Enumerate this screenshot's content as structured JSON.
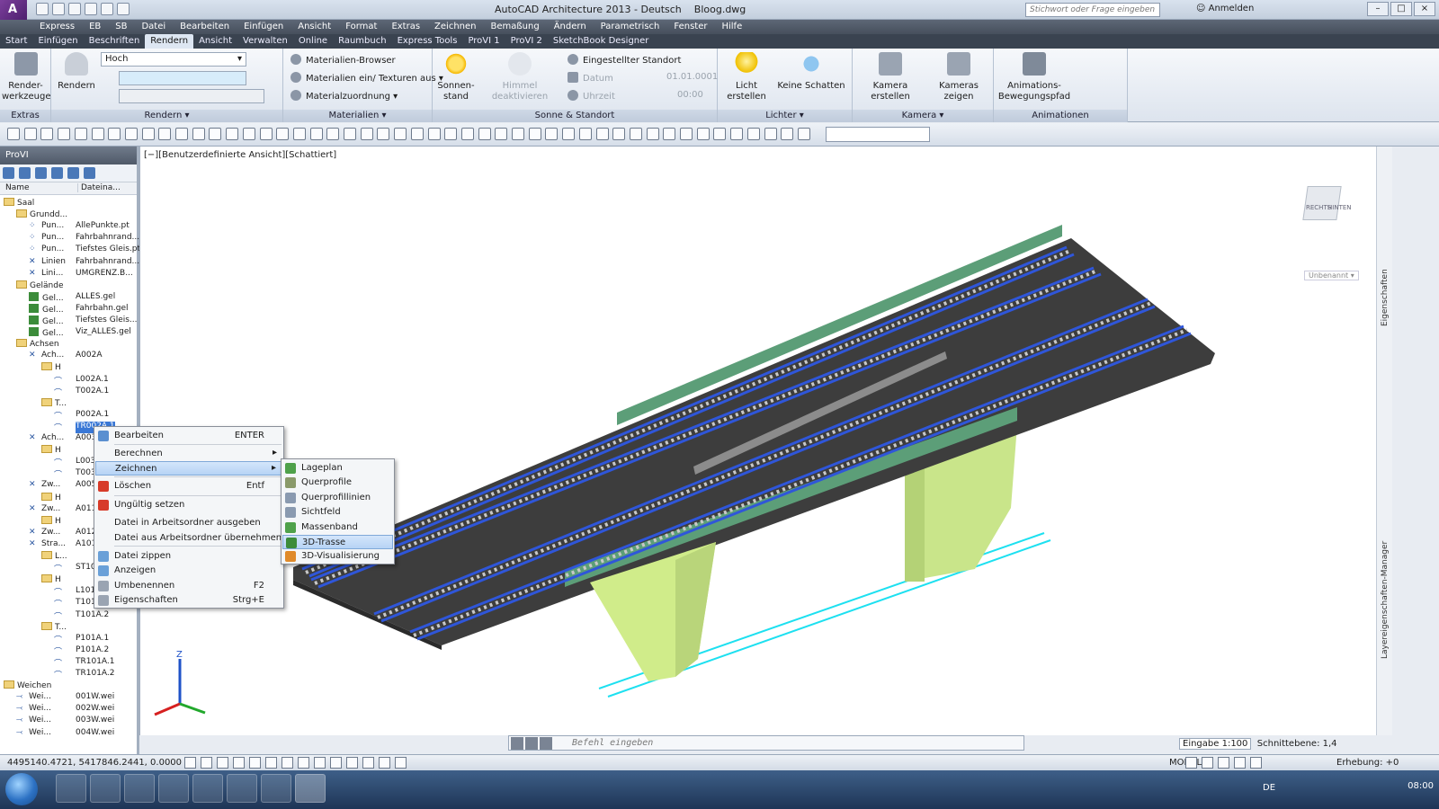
{
  "window": {
    "title": "AutoCAD Architecture 2013 - Deutsch",
    "file": "Bloog.dwg",
    "search_placeholder": "Stichwort oder Frage eingeben",
    "user": "Anmelden"
  },
  "menubar": [
    "Express",
    "EB",
    "SB",
    "Datei",
    "Bearbeiten",
    "Einfügen",
    "Ansicht",
    "Format",
    "Extras",
    "Zeichnen",
    "Bemaßung",
    "Ändern",
    "Parametrisch",
    "Fenster",
    "Hilfe"
  ],
  "ribbon_tabs": [
    "Start",
    "Einfügen",
    "Beschriften",
    "Rendern",
    "Ansicht",
    "Verwalten",
    "Online",
    "Raumbuch",
    "Express Tools",
    "ProVI 1",
    "ProVI 2",
    "SketchBook Designer"
  ],
  "active_tab": "Rendern",
  "ribbon": {
    "extras": {
      "label": "Extras",
      "button": "Render-\nwerkzeuge"
    },
    "rendern": {
      "label": "Rendern",
      "button": "Rendern",
      "quality": "Hoch"
    },
    "materialien": {
      "label": "Materialien",
      "items": [
        "Materialien-Browser",
        "Materialien ein/ Texturen aus",
        "Materialzuordnung"
      ]
    },
    "sonne": {
      "label": "Sonne & Standort",
      "sonnenstand": "Sonnen-\nstand",
      "himmel": "Himmel deaktivieren",
      "standort": "Eingestellter Standort",
      "datum_label": "Datum",
      "datum": "01.01.0001",
      "uhrzeit_label": "Uhrzeit",
      "uhrzeit": "00:00"
    },
    "lichter": {
      "label": "Lichter",
      "licht": "Licht\nerstellen",
      "schatten": "Keine Schatten"
    },
    "kamera": {
      "label": "Kamera",
      "erstellen": "Kamera erstellen",
      "zeigen": "Kameras zeigen"
    },
    "animationen": {
      "label": "Animationen",
      "pfad": "Animations-\nBewegungspfad"
    }
  },
  "left_panel": {
    "title": "ProVI",
    "col_name": "Name",
    "col_file": "Dateina...",
    "tree": [
      {
        "level": 0,
        "name": "Saal",
        "file": "",
        "icon": "folder"
      },
      {
        "level": 1,
        "name": "Grundd...",
        "file": "",
        "icon": "folder"
      },
      {
        "level": 2,
        "name": "Pun...",
        "file": "AllePunkte.pt",
        "icon": "points"
      },
      {
        "level": 2,
        "name": "Pun...",
        "file": "Fahrbahnrand...",
        "icon": "points"
      },
      {
        "level": 2,
        "name": "Pun...",
        "file": "Tiefstes Gleis.pt",
        "icon": "points"
      },
      {
        "level": 2,
        "name": "Linien",
        "file": "Fahrbahnrand...",
        "icon": "lines"
      },
      {
        "level": 2,
        "name": "Lini...",
        "file": "UMGRENZ.B...",
        "icon": "lines"
      },
      {
        "level": 1,
        "name": "Gelände",
        "file": "",
        "icon": "folder"
      },
      {
        "level": 2,
        "name": "Gel...",
        "file": "ALLES.gel",
        "icon": "terrain"
      },
      {
        "level": 2,
        "name": "Gel...",
        "file": "Fahrbahn.gel",
        "icon": "terrain"
      },
      {
        "level": 2,
        "name": "Gel...",
        "file": "Tiefstes Gleis...",
        "icon": "terrain"
      },
      {
        "level": 2,
        "name": "Gel...",
        "file": "Viz_ALLES.gel",
        "icon": "terrain"
      },
      {
        "level": 1,
        "name": "Achsen",
        "file": "",
        "icon": "folder"
      },
      {
        "level": 2,
        "name": "Ach...",
        "file": "A002A",
        "icon": "axis"
      },
      {
        "level": 3,
        "name": "H",
        "file": "",
        "icon": "folder"
      },
      {
        "level": 4,
        "name": "",
        "file": "L002A.1",
        "icon": "profile"
      },
      {
        "level": 4,
        "name": "",
        "file": "T002A.1",
        "icon": "profile"
      },
      {
        "level": 3,
        "name": "T...",
        "file": "",
        "icon": "folder"
      },
      {
        "level": 4,
        "name": "",
        "file": "P002A.1",
        "icon": "profile"
      },
      {
        "level": 4,
        "name": "",
        "file": "TR002A.1",
        "icon": "profile"
      },
      {
        "level": 2,
        "name": "Ach...",
        "file": "A003",
        "icon": "axis"
      },
      {
        "level": 3,
        "name": "H",
        "file": "",
        "icon": "folder"
      },
      {
        "level": 4,
        "name": "",
        "file": "L003",
        "icon": "profile"
      },
      {
        "level": 4,
        "name": "",
        "file": "T003",
        "icon": "profile"
      },
      {
        "level": 2,
        "name": "Zw...",
        "file": "A005",
        "icon": "axis"
      },
      {
        "level": 3,
        "name": "H",
        "file": "",
        "icon": "folder"
      },
      {
        "level": 2,
        "name": "Zw...",
        "file": "A011",
        "icon": "axis"
      },
      {
        "level": 3,
        "name": "H",
        "file": "",
        "icon": "folder"
      },
      {
        "level": 2,
        "name": "Zw...",
        "file": "A012",
        "icon": "axis"
      },
      {
        "level": 2,
        "name": "Stra...",
        "file": "A101",
        "icon": "axis"
      },
      {
        "level": 3,
        "name": "L...",
        "file": "",
        "icon": "folder"
      },
      {
        "level": 4,
        "name": "",
        "file": "ST10",
        "icon": "profile"
      },
      {
        "level": 3,
        "name": "H",
        "file": "",
        "icon": "folder"
      },
      {
        "level": 4,
        "name": "",
        "file": "L101",
        "icon": "profile"
      },
      {
        "level": 4,
        "name": "",
        "file": "T101",
        "icon": "profile"
      },
      {
        "level": 4,
        "name": "",
        "file": "T101A.2",
        "icon": "profile"
      },
      {
        "level": 3,
        "name": "T...",
        "file": "",
        "icon": "folder"
      },
      {
        "level": 4,
        "name": "",
        "file": "P101A.1",
        "icon": "profile"
      },
      {
        "level": 4,
        "name": "",
        "file": "P101A.2",
        "icon": "profile"
      },
      {
        "level": 4,
        "name": "",
        "file": "TR101A.1",
        "icon": "profile"
      },
      {
        "level": 4,
        "name": "",
        "file": "TR101A.2",
        "icon": "profile"
      },
      {
        "level": 0,
        "name": "Weichen",
        "file": "",
        "icon": "folder"
      },
      {
        "level": 1,
        "name": "Wei...",
        "file": "001W.wei",
        "icon": "switch"
      },
      {
        "level": 1,
        "name": "Wei...",
        "file": "002W.wei",
        "icon": "switch"
      },
      {
        "level": 1,
        "name": "Wei...",
        "file": "003W.wei",
        "icon": "switch"
      },
      {
        "level": 1,
        "name": "Wei...",
        "file": "004W.wei",
        "icon": "switch"
      }
    ]
  },
  "viewport": {
    "label": "[−][Benutzerdefinierte Ansicht][Schattiert]",
    "viewcube_faces": [
      "RECHTS",
      "HINTEN"
    ],
    "unnamed": "Unbenannt",
    "side_labels": [
      "Eigenschaften",
      "Layereigenschaften-Manager"
    ]
  },
  "context_menu": [
    {
      "label": "Bearbeiten",
      "shortcut": "ENTER"
    },
    {
      "label": "Berechnen",
      "shortcut": "",
      "submenu": true
    },
    {
      "label": "Zeichnen",
      "shortcut": "",
      "submenu": true,
      "highlight": true
    },
    {
      "label": "Löschen",
      "shortcut": "Entf"
    },
    {
      "label": "Ungültig setzen",
      "shortcut": ""
    },
    {
      "label": "Datei in Arbeitsordner ausgeben",
      "shortcut": ""
    },
    {
      "label": "Datei aus Arbeitsordner übernehmen",
      "shortcut": ""
    },
    {
      "label": "Datei zippen",
      "shortcut": ""
    },
    {
      "label": "Anzeigen",
      "shortcut": ""
    },
    {
      "label": "Umbenennen",
      "shortcut": "F2"
    },
    {
      "label": "Eigenschaften",
      "shortcut": "Strg+E"
    }
  ],
  "submenu": [
    {
      "label": "Lageplan"
    },
    {
      "label": "Querprofile"
    },
    {
      "label": "Querprofillinien"
    },
    {
      "label": "Sichtfeld"
    },
    {
      "label": "Massenband"
    },
    {
      "label": "3D-Trasse",
      "highlight": true
    },
    {
      "label": "3D-Visualisierung"
    }
  ],
  "command_line": {
    "placeholder": "Befehl eingeben"
  },
  "annotation": {
    "scale": "Eingabe 1:100",
    "cut_plane": "Schnittebene: 1,4"
  },
  "status": {
    "coords": "4495140.4721, 5417846.2441, 0.0000",
    "model": "MODELL",
    "elevation": "Erhebung: +0"
  },
  "taskbar": {
    "lang": "DE",
    "time": "08:00"
  },
  "colors": {
    "deck": "#3a3a3a",
    "rail": "#2f56d9",
    "pier": "#d0ec8a",
    "girder": "#5c9e78",
    "cyan_line": "#1de0f0"
  }
}
